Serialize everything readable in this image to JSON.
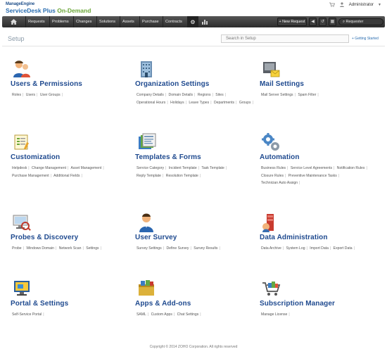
{
  "brand": {
    "logo_top": "ManageEngine",
    "logo_main_a": "ServiceDesk Plus ",
    "logo_main_b": "On-Demand",
    "user": "Administrator"
  },
  "nav": {
    "items": [
      "Requests",
      "Problems",
      "Changes",
      "Solutions",
      "Assets",
      "Purchase",
      "Contracts"
    ],
    "new_request": "+ New Request",
    "search_placeholder": "Requester"
  },
  "sub": {
    "title": "Setup",
    "search_placeholder": "Search in Setup",
    "getting_started": "+ Getting Started"
  },
  "cards": [
    {
      "title": "Users & Permissions",
      "links": [
        "Roles",
        "Users",
        "User Groups"
      ]
    },
    {
      "title": "Organization Settings",
      "links": [
        "Company Details",
        "Domain Details",
        "Regions",
        "Sites",
        "Operational Hours",
        "Holidays",
        "Leave Types",
        "Departments",
        "Groups"
      ]
    },
    {
      "title": "Mail Settings",
      "links": [
        "Mail Server Settings",
        "Spam Filter"
      ]
    },
    {
      "title": "Customization",
      "links": [
        "Helpdesk",
        "Change Management",
        "Asset Management",
        "Purchase Management",
        "Additional Fields"
      ]
    },
    {
      "title": "Templates & Forms",
      "links": [
        "Service Category",
        "Incident Template",
        "Task Template",
        "Reply Template",
        "Resolution Template"
      ]
    },
    {
      "title": "Automation",
      "links": [
        "Business Rules",
        "Service Level Agreements",
        "Notification Rules",
        "Closure Rules",
        "Preventive Maintenance Tasks",
        "Technician Auto Assign"
      ]
    },
    {
      "title": "Probes & Discovery",
      "links": [
        "Probe",
        "Windows Domain",
        "Network Scan",
        "Settings"
      ]
    },
    {
      "title": "User Survey",
      "links": [
        "Survey Settings",
        "Define Survey",
        "Survey Results"
      ]
    },
    {
      "title": "Data Administration",
      "links": [
        "Data Archive",
        "System Log",
        "Import Data",
        "Export Data"
      ]
    },
    {
      "title": "Portal & Settings",
      "links": [
        "Self-Service Portal"
      ]
    },
    {
      "title": "Apps & Add-ons",
      "links": [
        "SAML",
        "Custom Apps",
        "Chat Settings"
      ]
    },
    {
      "title": "Subscription Manager",
      "links": [
        "Manage License"
      ]
    }
  ],
  "footer": "Copyright © 2014 ZOHO Corporation. All rights reserved"
}
